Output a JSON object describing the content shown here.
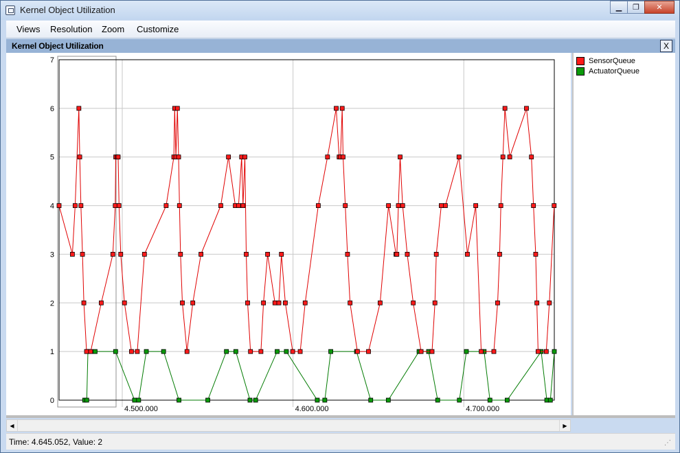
{
  "window": {
    "title": "Kernel Object Utilization",
    "minimize_label": "▁",
    "maximize_label": "❐",
    "close_label": "✕"
  },
  "menu": [
    {
      "label": "Views"
    },
    {
      "label": "Resolution"
    },
    {
      "label": "Zoom"
    },
    {
      "label": "Customize"
    }
  ],
  "panel": {
    "title": "Kernel Object Utilization",
    "close_label": "X"
  },
  "status": {
    "text": "Time: 4.645.052, Value: 2"
  },
  "chart_data": {
    "type": "line",
    "xlim": [
      4463000,
      4753000
    ],
    "ylim": [
      0,
      7
    ],
    "y_ticks": [
      0,
      1,
      2,
      3,
      4,
      5,
      6,
      7
    ],
    "x_ticks": [
      {
        "value": 4500000,
        "label": "4.500.000"
      },
      {
        "value": 4600000,
        "label": "4.600.000"
      },
      {
        "value": 4700000,
        "label": "4.700.000"
      }
    ],
    "grid": true,
    "legend_position": "right",
    "selection_box": [
      4463000,
      4500000
    ],
    "series": [
      {
        "name": "SensorQueue",
        "color": "#e00000",
        "marker_fill": "#ff1a1a",
        "x": [
          4463000,
          4470800,
          4472400,
          4474600,
          4475100,
          4475800,
          4476700,
          4477500,
          4479100,
          4481500,
          4487700,
          4494500,
          4495900,
          4496200,
          4497100,
          4497600,
          4498100,
          4499100,
          4501300,
          4505400,
          4508800,
          4513000,
          4525700,
          4530200,
          4530700,
          4531400,
          4532300,
          4533000,
          4533500,
          4534100,
          4535200,
          4537900,
          4541300,
          4546100,
          4557700,
          4562200,
          4566200,
          4568100,
          4569900,
          4570700,
          4571800,
          4572600,
          4573400,
          4575100,
          4581200,
          4582700,
          4585100,
          4589400,
          4591700,
          4593200,
          4595500,
          4599800,
          4604200,
          4607100,
          4614800,
          4620200,
          4625300,
          4627000,
          4627800,
          4628800,
          4629300,
          4630600,
          4631900,
          4633400,
          4637700,
          4644200,
          4651000,
          4655900,
          4660300,
          4660800,
          4661700,
          4662700,
          4664200,
          4666900,
          4670400,
          4675000,
          4681400,
          4683100,
          4683900,
          4686800,
          4689200,
          4697200,
          4702100,
          4707000,
          4710200,
          4717600,
          4719800,
          4721000,
          4721700,
          4722900,
          4724100,
          4726900,
          4736700,
          4739600,
          4740800,
          4742100,
          4742800,
          4743500,
          4748300,
          4750100,
          4752900
        ],
        "y": [
          4,
          3,
          4,
          6,
          5,
          4,
          3,
          2,
          1,
          1,
          2,
          3,
          4,
          5,
          5,
          5,
          4,
          3,
          2,
          1,
          1,
          3,
          4,
          5,
          6,
          5,
          6,
          5,
          4,
          3,
          2,
          1,
          2,
          3,
          4,
          5,
          4,
          4,
          5,
          4,
          5,
          3,
          2,
          1,
          1,
          2,
          3,
          2,
          2,
          3,
          2,
          1,
          1,
          2,
          4,
          5,
          6,
          5,
          5,
          6,
          5,
          4,
          3,
          2,
          1,
          1,
          2,
          4,
          3,
          3,
          4,
          5,
          4,
          3,
          2,
          1,
          1,
          2,
          3,
          4,
          4,
          5,
          3,
          4,
          1,
          1,
          2,
          3,
          4,
          5,
          6,
          5,
          6,
          5,
          4,
          3,
          2,
          1,
          1,
          2,
          4
        ],
        "point_count": 101
      },
      {
        "name": "ActuatorQueue",
        "color": "#007a00",
        "marker_fill": "#0a9a0a",
        "x": [
          4478000,
          4479200,
          4479900,
          4484100,
          4496100,
          4507200,
          4509600,
          4514100,
          4524200,
          4533200,
          4550100,
          4561000,
          4566500,
          4574800,
          4578100,
          4590700,
          4596100,
          4614200,
          4618600,
          4622100,
          4637200,
          4645500,
          4655800,
          4673800,
          4679400,
          4684700,
          4697400,
          4701500,
          4711900,
          4715300,
          4725400,
          4745300,
          4748600,
          4750700,
          4753000
        ],
        "y": [
          0,
          0,
          1,
          1,
          1,
          0,
          0,
          1,
          1,
          0,
          0,
          1,
          1,
          0,
          0,
          1,
          1,
          0,
          0,
          1,
          1,
          0,
          0,
          1,
          1,
          0,
          0,
          1,
          1,
          0,
          0,
          1,
          0,
          0,
          1
        ]
      }
    ]
  }
}
